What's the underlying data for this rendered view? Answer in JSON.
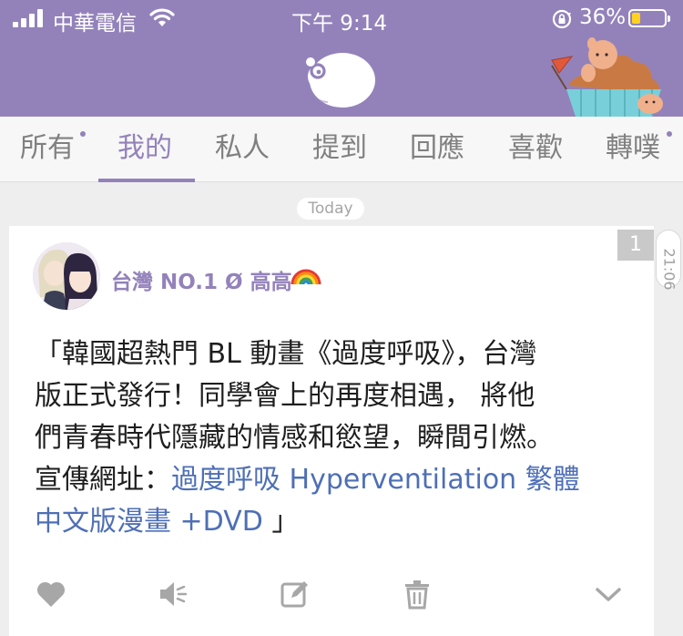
{
  "status_bar": {
    "carrier": "中華電信",
    "time": "下午 9:14",
    "battery_percent": "36%",
    "battery_level": 0.36
  },
  "tabs": [
    {
      "label": "所有",
      "active": false,
      "dot": true
    },
    {
      "label": "我的",
      "active": true,
      "dot": false
    },
    {
      "label": "私人",
      "active": false,
      "dot": false
    },
    {
      "label": "提到",
      "active": false,
      "dot": false
    },
    {
      "label": "回應",
      "active": false,
      "dot": false
    },
    {
      "label": "喜歡",
      "active": false,
      "dot": false
    },
    {
      "label": "轉噗",
      "active": false,
      "dot": true
    }
  ],
  "feed": {
    "date_label": "Today",
    "post": {
      "count": "1",
      "time": "21:06",
      "username": "台灣 NO.1 Ø 高高",
      "text_lines": [
        "「韓國超熱門 BL 動畫《過度呼吸》，台灣",
        "版正式發行！同學會上的再度相遇， 將他",
        "們青春時代隱藏的情感和慾望，瞬間引燃。"
      ],
      "text_prefix": "宣傳網址：",
      "link_text_1": "過度呼吸 Hyperventilation 繁體",
      "link_text_2": "中文版漫畫 +DVD",
      "text_suffix": " 」"
    },
    "actions": [
      "heart-icon",
      "mute-icon",
      "edit-icon",
      "trash-icon",
      "chevron-down-icon"
    ]
  },
  "colors": {
    "brand": "#9382ba",
    "link": "#4e6fb6",
    "battery": "#ffd21f"
  }
}
